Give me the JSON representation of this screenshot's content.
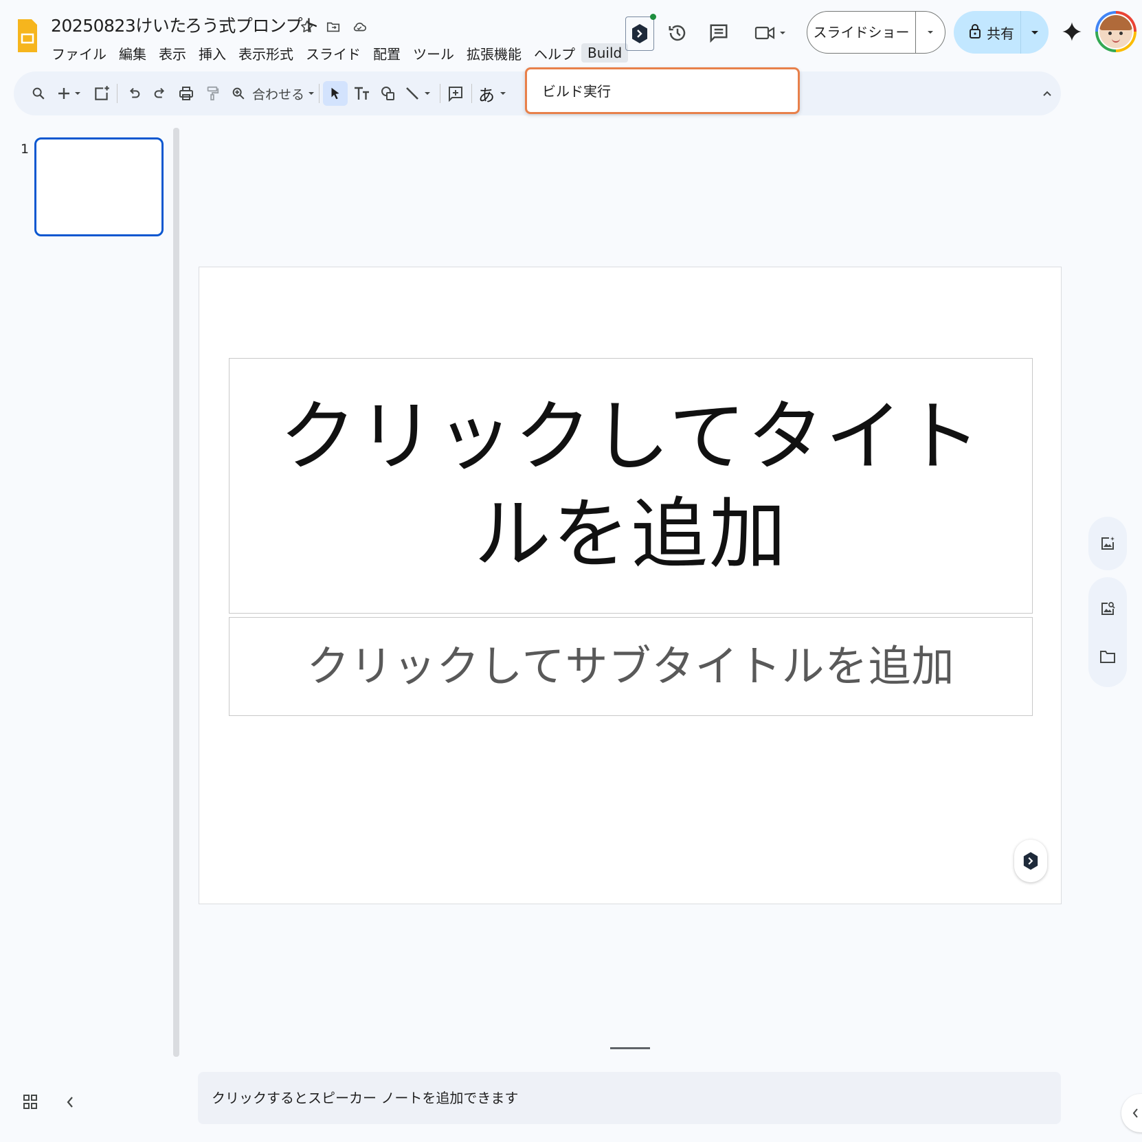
{
  "header": {
    "doc_title": "20250823けいたろう式プロンプト",
    "menu": [
      "ファイル",
      "編集",
      "表示",
      "挿入",
      "表示形式",
      "スライド",
      "配置",
      "ツール",
      "拡張機能",
      "ヘルプ",
      "Build"
    ],
    "slideshow_label": "スライドショー",
    "share_label": "共有"
  },
  "toolbar": {
    "zoom_label": "合わせる",
    "input_mode_label": "あ"
  },
  "dropdown": {
    "items": [
      "ビルド実行"
    ]
  },
  "filmstrip": {
    "slide_number": "1"
  },
  "slide": {
    "title_placeholder": "クリックしてタイトルを追加",
    "subtitle_placeholder": "クリックしてサブタイトルを追加"
  },
  "notes": {
    "placeholder": "クリックするとスピーカー ノートを追加できます"
  },
  "colors": {
    "accent_blue": "#0b57d0",
    "share_bg": "#c2e7ff",
    "dropdown_border": "#e8804a",
    "slides_yellow": "#f6b51d"
  }
}
